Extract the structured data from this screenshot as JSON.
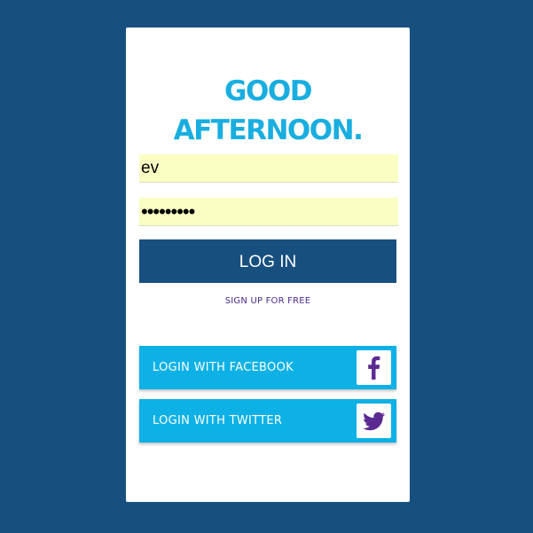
{
  "greeting": {
    "line1": "GOOD",
    "line2": "AFTERNOON."
  },
  "form": {
    "username_value": "ev",
    "password_value": "•••••••••",
    "login_label": "LOG IN",
    "signup_label": "SIGN UP FOR FREE"
  },
  "social": {
    "facebook_label": "LOGIN WITH FACEBOOK",
    "facebook_icon": "facebook-icon",
    "twitter_label": "LOGIN WITH TWITTER",
    "twitter_icon": "twitter-icon"
  },
  "colors": {
    "background": "#174f7f",
    "accent": "#19aee0",
    "social_button": "#0db1e5",
    "icon": "#5b2a91",
    "field": "#fafec3"
  }
}
